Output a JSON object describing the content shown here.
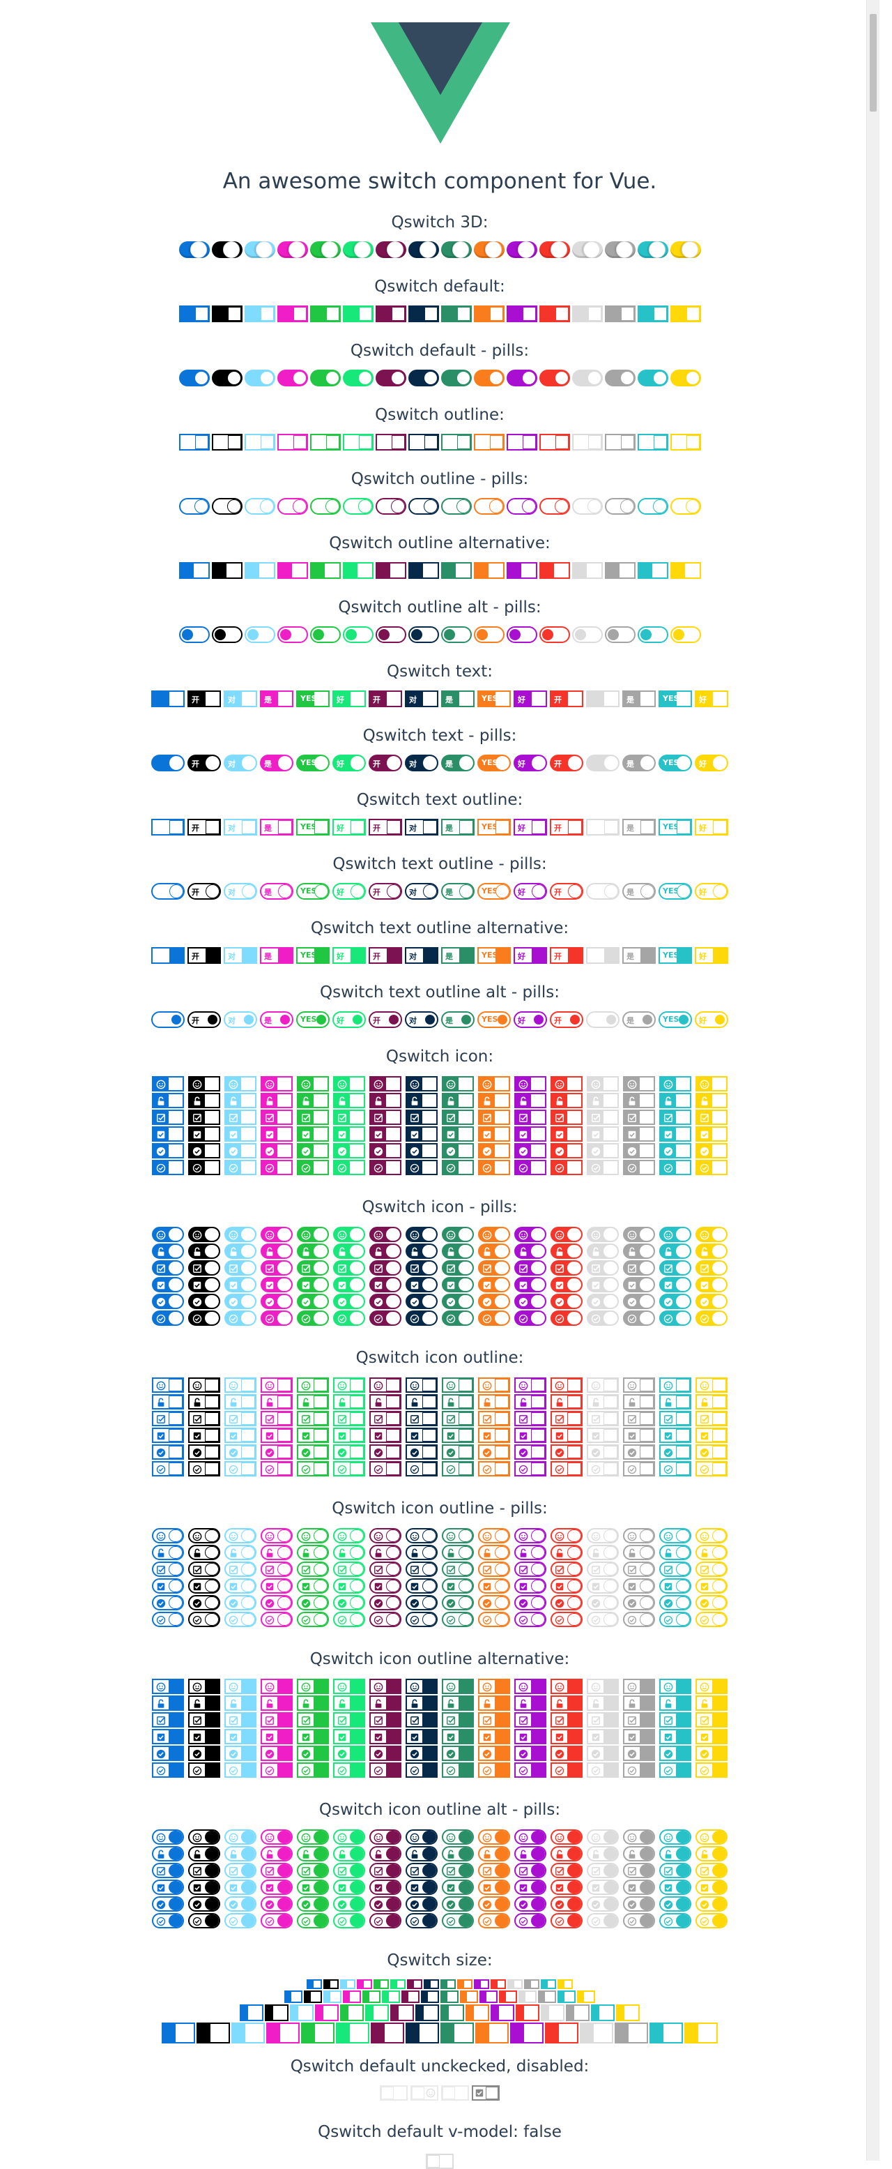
{
  "tagline": "An awesome switch component for Vue.",
  "colors": [
    "#0b74d8",
    "#000000",
    "#80dcff",
    "#ef1ec6",
    "#21c743",
    "#18e87a",
    "#7c1350",
    "#06294a",
    "#2a8f67",
    "#fa7d1d",
    "#a90fd1",
    "#f5352a",
    "#dcdcdc",
    "#a5a5a5",
    "#27c2c8",
    "#ffd80a"
  ],
  "text_labels": [
    "",
    "开",
    "对",
    "是",
    "YES",
    "好",
    "开",
    "对",
    "是",
    "YES",
    "好",
    "开",
    "",
    "是",
    "YES",
    "好"
  ],
  "sections": [
    {
      "title": "Qswitch 3D:",
      "style": "3d"
    },
    {
      "title": "Qswitch default:",
      "style": "default"
    },
    {
      "title": "Qswitch default - pills:",
      "style": "default-pill"
    },
    {
      "title": "Qswitch outline:",
      "style": "outline"
    },
    {
      "title": "Qswitch outline - pills:",
      "style": "outline-pill"
    },
    {
      "title": "Qswitch outline alternative:",
      "style": "outline-alt"
    },
    {
      "title": "Qswitch outline alt - pills:",
      "style": "outline-alt-pill"
    },
    {
      "title": "Qswitch text:",
      "style": "text"
    },
    {
      "title": "Qswitch text - pills:",
      "style": "text-pill"
    },
    {
      "title": "Qswitch text outline:",
      "style": "text-outline"
    },
    {
      "title": "Qswitch text outline - pills:",
      "style": "text-outline-pill"
    },
    {
      "title": "Qswitch text outline alternative:",
      "style": "text-outline-alt"
    },
    {
      "title": "Qswitch text outline alt - pills:",
      "style": "text-outline-alt-pill"
    },
    {
      "title": "Qswitch icon:",
      "style": "icon"
    },
    {
      "title": "Qswitch icon - pills:",
      "style": "icon-pill"
    },
    {
      "title": "Qswitch icon outline:",
      "style": "icon-outline"
    },
    {
      "title": "Qswitch icon outline - pills:",
      "style": "icon-outline-pill"
    },
    {
      "title": "Qswitch icon outline alternative:",
      "style": "icon-outline-alt"
    },
    {
      "title": "Qswitch icon outline alt - pills:",
      "style": "icon-outline-alt-pill"
    },
    {
      "title": "Qswitch size:",
      "style": "size"
    },
    {
      "title": "Qswitch default unckecked, disabled:",
      "style": "disabled"
    },
    {
      "title": "Qswitch default v-model: false",
      "style": "vmodel"
    }
  ],
  "icons": [
    "smile-icon",
    "unlock-icon",
    "check-square-icon",
    "checkbox-check-icon",
    "check-icon",
    "check-circle-icon"
  ],
  "vmodel_value": "false"
}
